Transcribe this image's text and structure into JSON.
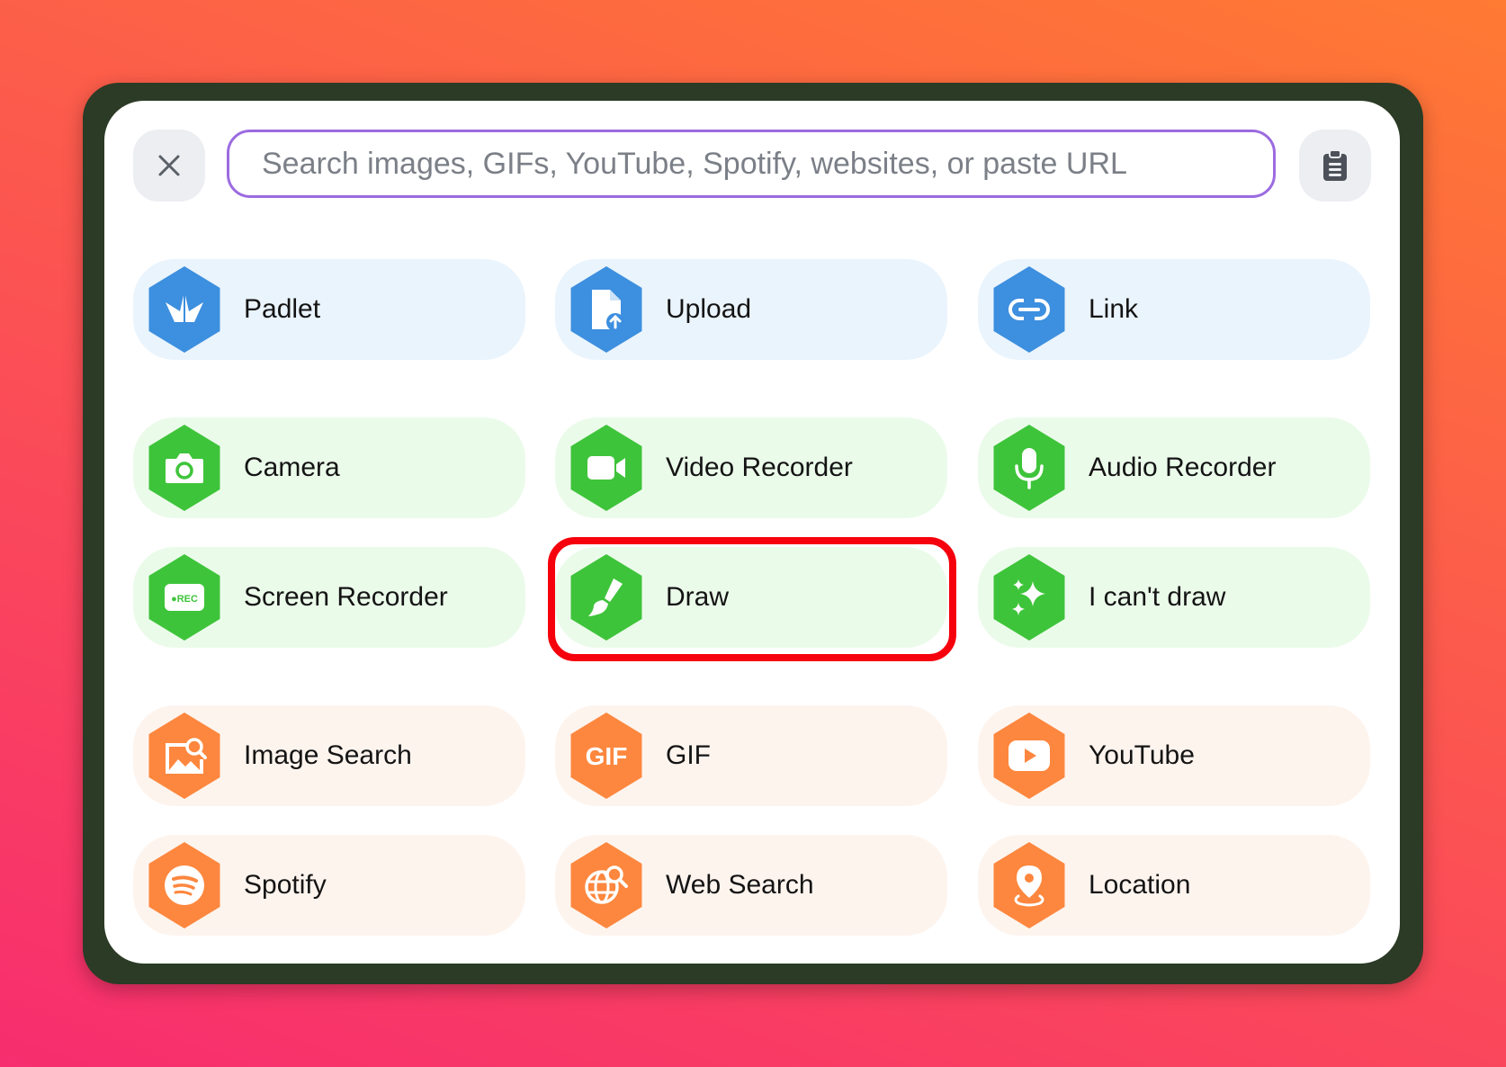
{
  "toolbar": {
    "close_icon": "close-icon",
    "clipboard_icon": "clipboard-icon"
  },
  "search": {
    "placeholder": "Search images, GIFs, YouTube, Spotify, websites, or paste URL",
    "value": ""
  },
  "tiles": [
    {
      "label": "Padlet",
      "icon": "padlet-crane-icon",
      "color": "#3d8fdf",
      "group": "blue"
    },
    {
      "label": "Upload",
      "icon": "upload-file-icon",
      "color": "#3d8fdf",
      "group": "blue"
    },
    {
      "label": "Link",
      "icon": "link-icon",
      "color": "#3d8fdf",
      "group": "blue"
    },
    {
      "label": "Camera",
      "icon": "camera-icon",
      "color": "#3ec43a",
      "group": "green"
    },
    {
      "label": "Video Recorder",
      "icon": "video-camera-icon",
      "color": "#3ec43a",
      "group": "green"
    },
    {
      "label": "Audio Recorder",
      "icon": "microphone-icon",
      "color": "#3ec43a",
      "group": "green"
    },
    {
      "label": "Screen Recorder",
      "icon": "screen-rec-icon",
      "icon_text": "●REC",
      "color": "#3ec43a",
      "group": "green"
    },
    {
      "label": "Draw",
      "icon": "paintbrush-icon",
      "color": "#3ec43a",
      "group": "green",
      "highlighted": true
    },
    {
      "label": "I can't draw",
      "icon": "sparkles-icon",
      "color": "#3ec43a",
      "group": "green"
    },
    {
      "label": "Image Search",
      "icon": "image-search-icon",
      "color": "#fd873e",
      "group": "orange"
    },
    {
      "label": "GIF",
      "icon": "gif-icon",
      "icon_text": "GIF",
      "color": "#fd873e",
      "group": "orange"
    },
    {
      "label": "YouTube",
      "icon": "youtube-icon",
      "color": "#fd873e",
      "group": "orange"
    },
    {
      "label": "Spotify",
      "icon": "spotify-icon",
      "color": "#fd873e",
      "group": "orange"
    },
    {
      "label": "Web Search",
      "icon": "web-search-icon",
      "color": "#fd873e",
      "group": "orange"
    },
    {
      "label": "Location",
      "icon": "location-pin-icon",
      "color": "#fd873e",
      "group": "orange"
    }
  ],
  "colors": {
    "highlight": "#f5000c",
    "search_border": "#9b6be0",
    "frame": "#2b3b26"
  }
}
